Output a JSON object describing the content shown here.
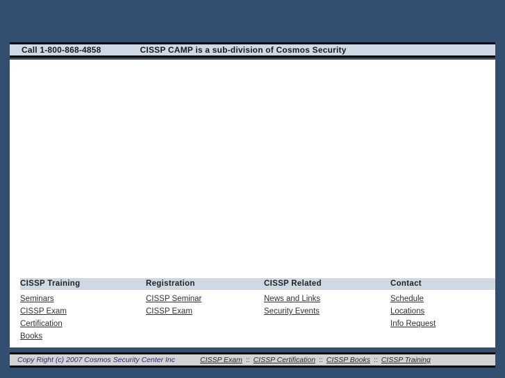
{
  "topbar": {
    "phone": "Call 1-800-868-4858",
    "tagline": "CISSP CAMP is a sub-division of Cosmos Security"
  },
  "sitemap": {
    "columns": [
      {
        "heading": "CISSP Training",
        "links": [
          "Seminars",
          "CISSP Exam",
          "Certification",
          "Books"
        ]
      },
      {
        "heading": "Registration",
        "links": [
          "CISSP Seminar",
          "CISSP Exam"
        ]
      },
      {
        "heading": "CISSP Related",
        "links": [
          "News and Links",
          "Security Events"
        ]
      },
      {
        "heading": "Contact",
        "links": [
          "Schedule",
          "Locations",
          "Info Request"
        ]
      }
    ]
  },
  "footer": {
    "copyright": "Copy Right (c) 2007 Cosmos Security Center Inc",
    "separator": "::",
    "links": [
      "CISSP Exam",
      "CISSP Certification",
      "CISSP Books",
      "CISSP Training"
    ]
  },
  "colors": {
    "page_background": "#334f70",
    "bar_background": "#ced9e5",
    "footer_bar_background": "#d4d4d4",
    "content_background": "#ffffff",
    "bar_border": "#0a0a0a",
    "copyright_text": "#2a2a80",
    "link_text": "#303030"
  }
}
